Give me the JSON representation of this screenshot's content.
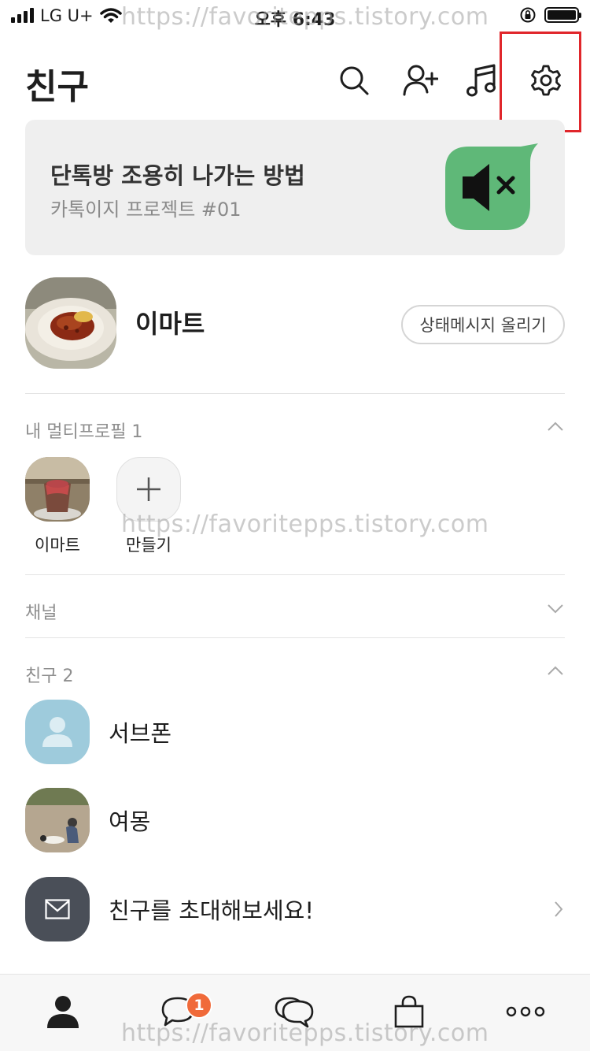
{
  "status_bar": {
    "carrier": "LG U+",
    "time": "오후 6:43"
  },
  "watermark": "https://favoritepps.tistory.com",
  "header": {
    "title": "친구"
  },
  "banner": {
    "title": "단톡방 조용히 나가는 방법",
    "subtitle": "카톡이지 프로젝트 #01",
    "accent_color": "#5fb878"
  },
  "my_profile": {
    "name": "이마트",
    "status_button": "상태메시지 올리기"
  },
  "multi_profile": {
    "header": "내 멀티프로필 1",
    "items": [
      {
        "label": "이마트"
      },
      {
        "label": "만들기"
      }
    ]
  },
  "channel": {
    "header": "채널"
  },
  "friends": {
    "header": "친구 2",
    "list": [
      {
        "name": "서브폰"
      },
      {
        "name": "여몽"
      }
    ],
    "invite": "친구를 초대해보세요!"
  },
  "tabbar": {
    "chat_badge": "1",
    "tabs": [
      "friends-tab",
      "chats-tab",
      "openchat-tab",
      "shopping-tab",
      "more-tab"
    ]
  },
  "colors": {
    "highlight": "#e0262b",
    "badge": "#f06a3a",
    "avatar_default": "#9ecbdc",
    "invite_icon_bg": "#4a4f58"
  }
}
